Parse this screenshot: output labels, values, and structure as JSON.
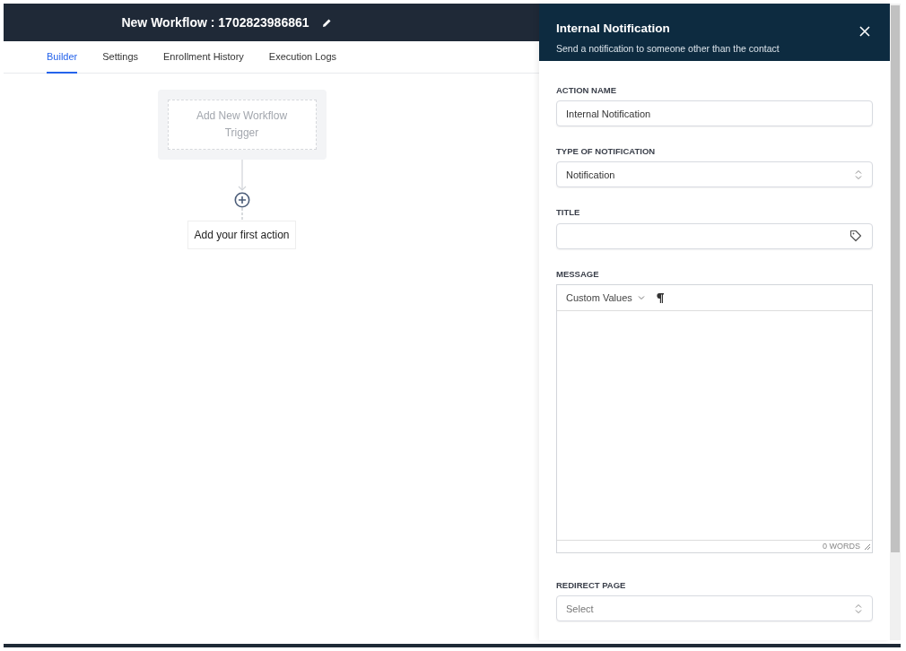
{
  "header": {
    "title": "New Workflow : 1702823986861"
  },
  "tabs": [
    {
      "label": "Builder",
      "selected": true
    },
    {
      "label": "Settings",
      "selected": false
    },
    {
      "label": "Enrollment History",
      "selected": false
    },
    {
      "label": "Execution Logs",
      "selected": false
    }
  ],
  "canvas": {
    "trigger": "Add New Workflow Trigger",
    "first_action": "Add your first action"
  },
  "panel": {
    "title": "Internal Notification",
    "subtitle": "Send a notification to someone other than the contact",
    "fields": [
      {
        "kind": "input",
        "label": "ACTION NAME",
        "value": "Internal Notification"
      },
      {
        "kind": "select",
        "label": "TYPE OF NOTIFICATION",
        "value": "Notification"
      },
      {
        "kind": "tag-input",
        "label": "TITLE"
      },
      {
        "kind": "editor",
        "label": "MESSAGE",
        "toolbar": "Custom Values",
        "word_count": "0 WORDS"
      },
      {
        "kind": "select",
        "label": "REDIRECT PAGE",
        "placeholder": "Select"
      }
    ]
  }
}
